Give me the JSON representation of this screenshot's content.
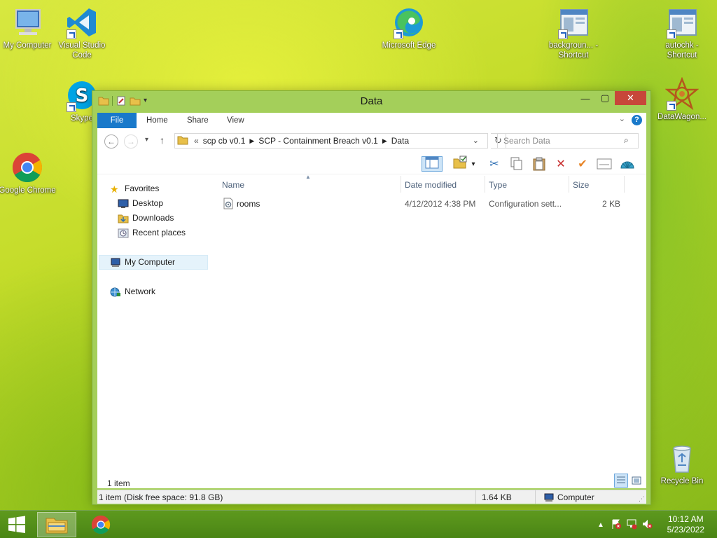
{
  "desktop": {
    "icons": [
      {
        "label": "My Computer"
      },
      {
        "label": "Visual Studio Code"
      },
      {
        "label": "Skype"
      },
      {
        "label": "Google Chrome"
      },
      {
        "label": "Microsoft Edge"
      },
      {
        "label": "backgroun... - Shortcut"
      },
      {
        "label": "autochk - Shortcut"
      },
      {
        "label": "DataWagon..."
      },
      {
        "label": "Recycle Bin"
      }
    ]
  },
  "window": {
    "title": "Data",
    "tabs": [
      "File",
      "Home",
      "Share",
      "View"
    ],
    "address": {
      "overflow": "«",
      "segments": [
        "scp cb v0.1",
        "SCP - Containment Breach v0.1",
        "Data"
      ]
    },
    "search": {
      "placeholder": "Search Data"
    },
    "nav": {
      "favorites_label": "Favorites",
      "favorites": [
        "Desktop",
        "Downloads",
        "Recent places"
      ],
      "my_computer": "My Computer",
      "network": "Network"
    },
    "columns": [
      "Name",
      "Date modified",
      "Type",
      "Size"
    ],
    "files": [
      {
        "name": "rooms",
        "date": "4/12/2012 4:38 PM",
        "type": "Configuration sett...",
        "size": "2 KB"
      }
    ],
    "item_count": "1 item",
    "status": {
      "left": "1 item (Disk free space: 91.8 GB)",
      "size": "1.64 KB",
      "location": "Computer"
    }
  },
  "taskbar": {
    "clock_time": "10:12 AM",
    "clock_date": "5/23/2022"
  },
  "colors": {
    "accent": "#1979ca",
    "window_frame": "#a4cf5a",
    "close": "#c7463a"
  }
}
